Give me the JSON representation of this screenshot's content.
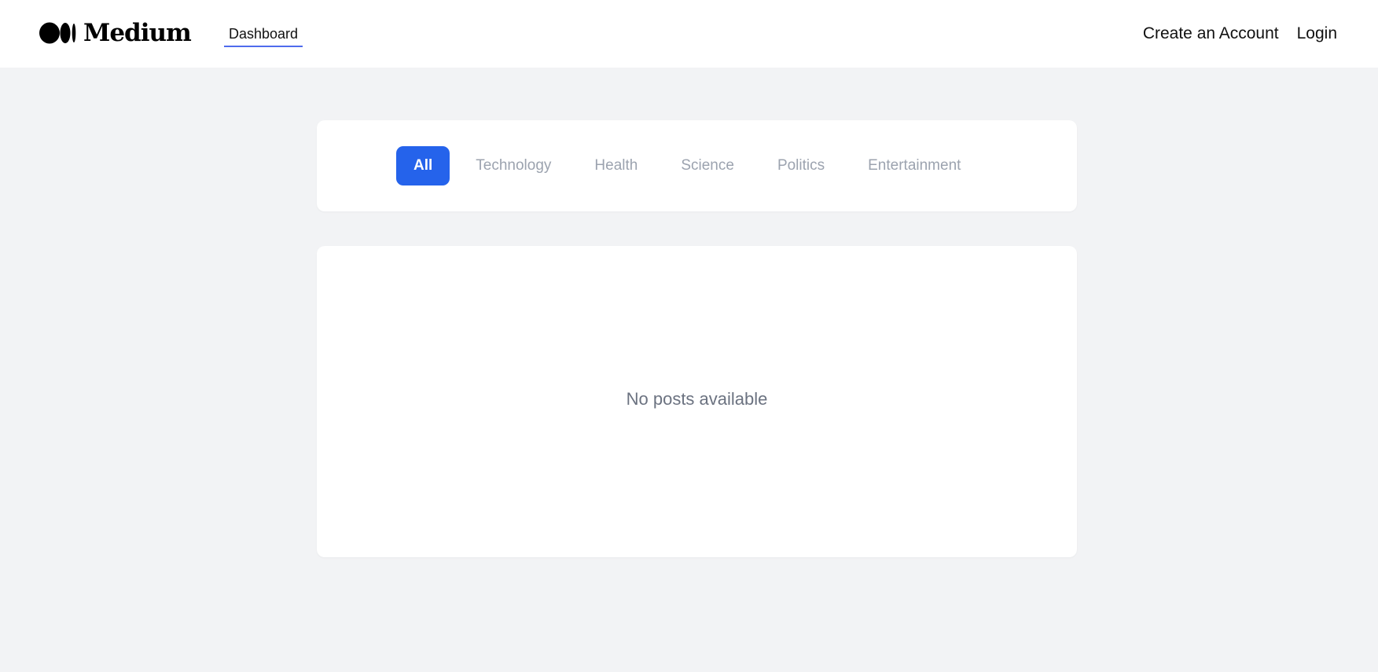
{
  "brand": {
    "name": "Medium",
    "logo_icon": "medium-logo-icon"
  },
  "nav": {
    "dashboard_label": "Dashboard",
    "create_account_label": "Create an Account",
    "login_label": "Login",
    "accent_color": "#4f6bed"
  },
  "categories": {
    "active": "All",
    "active_color": "#2563eb",
    "items": [
      {
        "label": "All"
      },
      {
        "label": "Technology"
      },
      {
        "label": "Health"
      },
      {
        "label": "Science"
      },
      {
        "label": "Politics"
      },
      {
        "label": "Entertainment"
      }
    ]
  },
  "posts": {
    "empty_message": "No posts available"
  }
}
